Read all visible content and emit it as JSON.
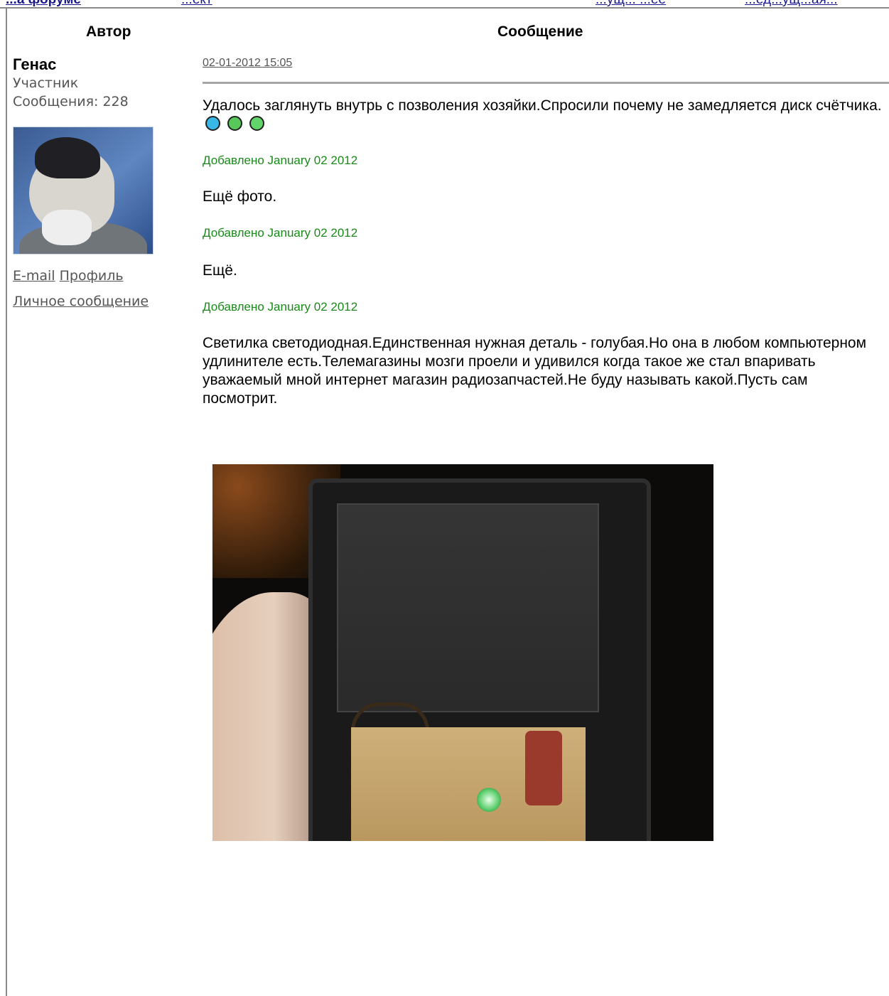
{
  "breadcrumb": {
    "left_bold": "...а форуме",
    "left_plain": "...ект",
    "right_1": "...ущ... ...ее",
    "right_2": "...ед...ущ...ая..."
  },
  "table_headers": {
    "author": "Автор",
    "message": "Сообщение"
  },
  "author": {
    "name": "Генас",
    "role": "Участник",
    "posts_label": "Сообщения: 228",
    "links": {
      "email": "E-mail",
      "profile": "Профиль",
      "pm": "Личное сообщение"
    }
  },
  "post": {
    "date": "02-01-2012 15:05",
    "paragraph_1": "Удалось заглянуть внутрь с позволения хозяйки.Спросили почему не замедляется диск счётчика.",
    "added_1": "Добавлено January 02 2012",
    "paragraph_2": "Ещё фото.",
    "added_2": "Добавлено January 02 2012",
    "paragraph_3": "Ещё.",
    "added_3": "Добавлено January 02 2012",
    "paragraph_4": "Светилка светодиодная.Единственная нужная деталь - голубая.Но она в любом компьютерном удлинителе есть.Телемагазины мозги проели и удивился когда такое же стал впаривать уважаемый мной интернет магазин радиозапчастей.Не буду называть какой.Пусть сам посмотрит."
  },
  "icons": {
    "smileys": [
      "sad-smiley-icon",
      "grin-smiley-icon",
      "wink-smiley-icon"
    ]
  },
  "colors": {
    "added_text": "#1a8a1a",
    "link": "#555555",
    "breadcrumb_link": "#1a1a8c",
    "rule": "#a6a6a6"
  }
}
